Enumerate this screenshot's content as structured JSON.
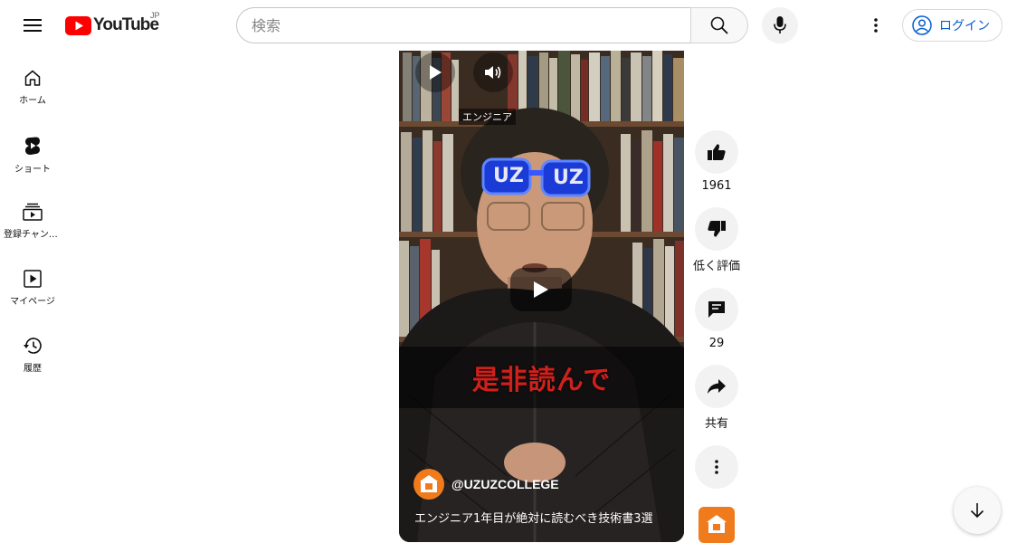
{
  "header": {
    "logo_text": "YouTube",
    "region": "JP",
    "search_placeholder": "検索",
    "login_label": "ログイン"
  },
  "sidebar": {
    "items": [
      {
        "label": "ホーム",
        "icon": "home-icon"
      },
      {
        "label": "ショート",
        "icon": "shorts-icon"
      },
      {
        "label": "登録チャンネル",
        "icon": "subscriptions-icon"
      },
      {
        "label": "マイページ",
        "icon": "library-icon"
      },
      {
        "label": "履歴",
        "icon": "history-icon"
      }
    ]
  },
  "video": {
    "overlay_badge": "エンジニア",
    "glasses_text_left": "UZ",
    "glasses_text_right": "UZ",
    "caption": "是非読んで",
    "channel_handle": "@UZUZCOLLEGE",
    "title": "エンジニア1年目が絶対に読むべき技術書3選"
  },
  "actions": {
    "like_count": "1961",
    "dislike_label": "低く評価",
    "comment_count": "29",
    "share_label": "共有"
  },
  "colors": {
    "brand_red": "#ff0000",
    "link_blue": "#065fd4",
    "channel_orange": "#f07b1d",
    "caption_red": "#d0201c"
  }
}
